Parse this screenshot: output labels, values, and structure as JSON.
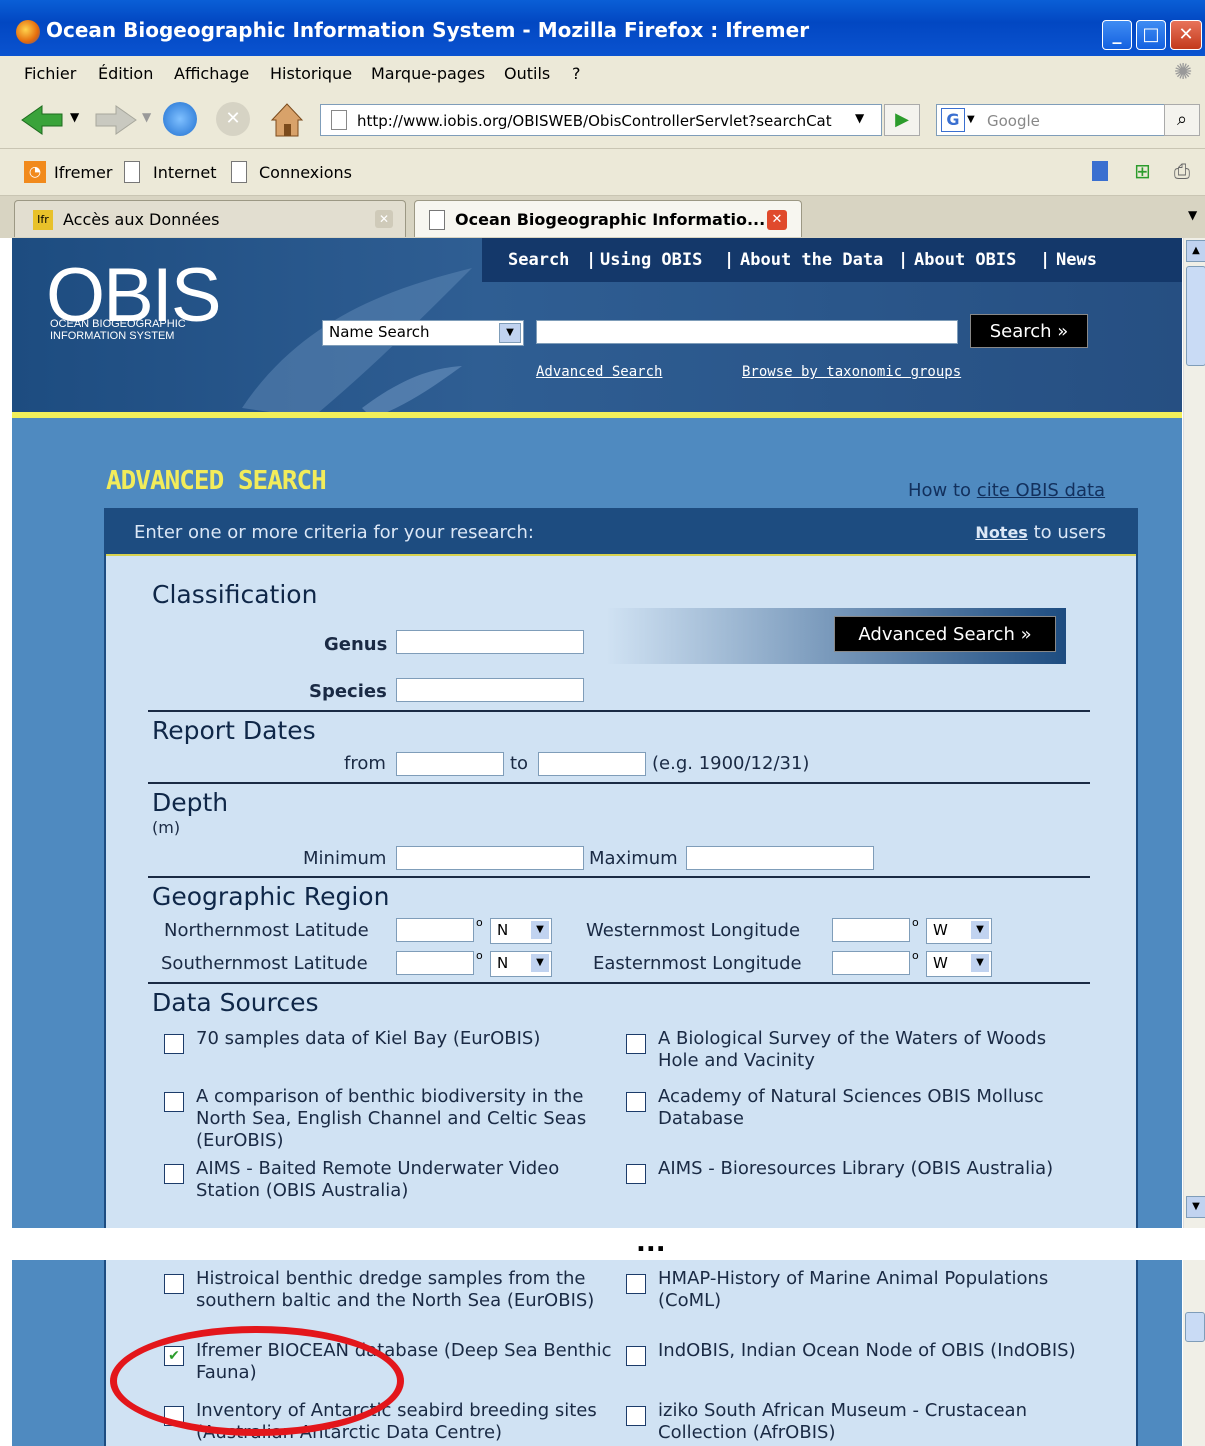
{
  "window": {
    "title": "Ocean Biogeographic Information System - Mozilla Firefox : Ifremer"
  },
  "menu": [
    "Fichier",
    "Édition",
    "Affichage",
    "Historique",
    "Marque-pages",
    "Outils",
    "?"
  ],
  "nav": {
    "url": "http://www.iobis.org/OBISWEB/ObisControllerServlet?searchCat",
    "search_placeholder": "Google"
  },
  "bookmarks": [
    "Ifremer",
    "Internet",
    "Connexions"
  ],
  "tabs": [
    {
      "label": "Accès aux Données"
    },
    {
      "label": "Ocean Biogeographic Informatio..."
    }
  ],
  "header": {
    "logo": "OBIS",
    "logo_sub": "OCEAN BIOGEOGRAPHIC INFORMATION SYSTEM",
    "nav": [
      "Search",
      "|",
      "Using OBIS",
      "|",
      "About the Data",
      "|",
      "About OBIS",
      "|",
      "News"
    ],
    "search_select": "Name Search",
    "search_button": "Search »",
    "link_advanced": "Advanced Search",
    "link_browse": "Browse by taxonomic groups"
  },
  "adv": {
    "title": "ADVANCED SEARCH",
    "howto": "How to",
    "howto_link": "cite OBIS data",
    "prompt": "Enter one or more criteria for your research:",
    "notes_link": "Notes",
    "notes_rest": "to users",
    "button": "Advanced Search »"
  },
  "classification": {
    "title": "Classification",
    "genus": "Genus",
    "species": "Species"
  },
  "dates": {
    "title": "Report Dates",
    "from": "from",
    "to": "to",
    "example": "(e.g. 1900/12/31)"
  },
  "depth": {
    "title": "Depth",
    "unit": "(m)",
    "min": "Minimum",
    "max": "Maximum"
  },
  "geo": {
    "title": "Geographic Region",
    "north": "Northernmost Latitude",
    "south": "Southernmost Latitude",
    "west": "Westernmost Longitude",
    "east": "Easternmost Longitude",
    "deg": "o",
    "n": "N",
    "w": "W"
  },
  "sources": {
    "title": "Data Sources",
    "items": [
      {
        "label": "70 samples data of Kiel Bay (EurOBIS)",
        "checked": false
      },
      {
        "label": "A Biological Survey of the Waters of Woods Hole and Vacinity",
        "checked": false
      },
      {
        "label": "A comparison of benthic biodiversity in the North Sea, English Channel and Celtic Seas (EurOBIS)",
        "checked": false
      },
      {
        "label": "Academy of Natural Sciences OBIS Mollusc Database",
        "checked": false
      },
      {
        "label": "AIMS - Baited Remote Underwater Video Station (OBIS Australia)",
        "checked": false
      },
      {
        "label": "AIMS - Bioresources Library (OBIS Australia)",
        "checked": false
      }
    ],
    "items2": [
      {
        "label": "Histroical benthic dredge samples from the southern baltic and the North Sea (EurOBIS)",
        "checked": false
      },
      {
        "label": "HMAP-History of Marine Animal Populations (CoML)",
        "checked": false
      },
      {
        "label": "Ifremer BIOCEAN database (Deep Sea Benthic Fauna)",
        "checked": true
      },
      {
        "label": "IndOBIS, Indian Ocean Node of OBIS (IndOBIS)",
        "checked": false
      },
      {
        "label": "Inventory of Antarctic seabird breeding sites (Australian Antarctic Data Centre)",
        "checked": false
      },
      {
        "label": "iziko South African Museum - Crustacean Collection (AfrOBIS)",
        "checked": false
      }
    ]
  },
  "ellipsis": "...",
  "colors": {
    "accent_circle": "#e3161b",
    "header_blue": "#1d4c80",
    "title_yellow": "#f2ec5a"
  }
}
